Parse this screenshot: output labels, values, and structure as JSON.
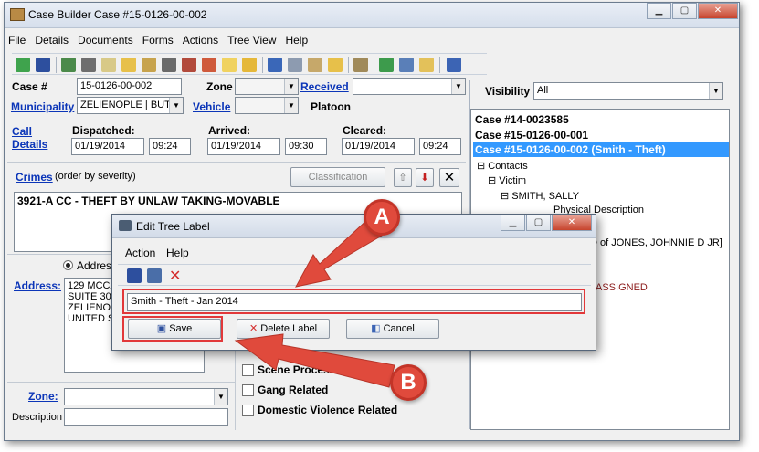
{
  "window": {
    "title": "Case Builder Case #15-0126-00-002"
  },
  "menu": [
    "File",
    "Details",
    "Documents",
    "Forms",
    "Actions",
    "Tree View",
    "Help"
  ],
  "toolbar_icons": [
    "add-icon",
    "save-icon",
    "open-icon",
    "camera-icon",
    "note-icon",
    "hand-icon",
    "edit-icon",
    "link-icon",
    "car-icon",
    "vehicle-icon",
    "bulb-icon",
    "pencil-icon",
    "list-icon",
    "calendar-icon",
    "clipboard-icon",
    "hand2-icon",
    "copy-icon",
    "refresh-icon",
    "pages-icon",
    "folder-icon",
    "door-icon"
  ],
  "case": {
    "case_label": "Case #",
    "case_number": "15-0126-00-002",
    "zone_label": "Zone",
    "received_label": "Received",
    "municipality_label": "Municipality",
    "municipality_value": "ZELIENOPLE | BUT",
    "vehicle_label": "Vehicle",
    "platoon_label": "Platoon",
    "call_details_label": "Call Details",
    "dispatched_label": "Dispatched:",
    "dispatched_date": "01/19/2014",
    "dispatched_time": "09:24",
    "arrived_label": "Arrived:",
    "arrived_date": "01/19/2014",
    "arrived_time": "09:30",
    "cleared_label": "Cleared:",
    "cleared_date": "01/19/2014",
    "cleared_time": "09:24",
    "crimes_label": "Crimes",
    "crimes_note": "(order by severity)",
    "classification_label": "Classification",
    "crime_entry": "3921-A CC - THEFT BY UNLAW TAKING-MOVABLE",
    "address_radio": "Address",
    "address_label": "Address:",
    "address_lines": [
      "129 MCCA",
      "SUITE 30",
      "ZELIENO",
      "UNITED S"
    ],
    "zone2_label": "Zone:",
    "description_label": "Description"
  },
  "checks": [
    "Scene Processed",
    "Gang Related",
    "Domestic Violence Related"
  ],
  "visibility": {
    "label": "Visibility",
    "value": "All"
  },
  "tree": {
    "items": [
      "Case #14-0023585",
      "Case #15-0126-00-001",
      "Case #15-0126-00-002 (Smith - Theft)",
      "Contacts",
      "Victim",
      "SMITH, SALLY",
      "Physical Description"
    ],
    "fragment_1": "D of JONES, JOHNNIE D JR]",
    "fragment_2": "ASSIGNED"
  },
  "dialog": {
    "title": "Edit Tree Label",
    "menu": [
      "Action",
      "Help"
    ],
    "label_value": "Smith - Theft - Jan 2014",
    "save_label": "Save",
    "delete_label": "Delete Label",
    "cancel_label": "Cancel"
  },
  "callouts": {
    "a": "A",
    "b": "B"
  },
  "colors": {
    "accent": "#0b35b8",
    "selection": "#3399ff",
    "callout": "#e04a3c"
  }
}
